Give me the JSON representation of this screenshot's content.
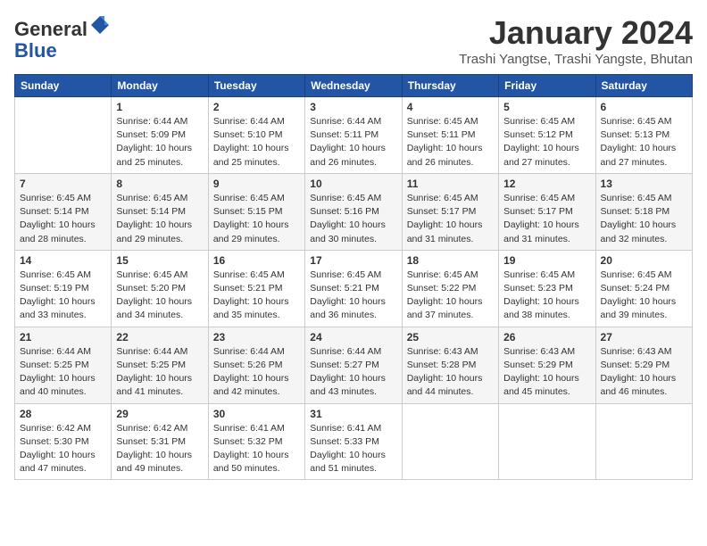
{
  "logo": {
    "general": "General",
    "blue": "Blue"
  },
  "header": {
    "month_title": "January 2024",
    "subtitle": "Trashi Yangtse, Trashi Yangste, Bhutan"
  },
  "days_of_week": [
    "Sunday",
    "Monday",
    "Tuesday",
    "Wednesday",
    "Thursday",
    "Friday",
    "Saturday"
  ],
  "weeks": [
    [
      {
        "day": "",
        "info": ""
      },
      {
        "day": "1",
        "info": "Sunrise: 6:44 AM\nSunset: 5:09 PM\nDaylight: 10 hours\nand 25 minutes."
      },
      {
        "day": "2",
        "info": "Sunrise: 6:44 AM\nSunset: 5:10 PM\nDaylight: 10 hours\nand 25 minutes."
      },
      {
        "day": "3",
        "info": "Sunrise: 6:44 AM\nSunset: 5:11 PM\nDaylight: 10 hours\nand 26 minutes."
      },
      {
        "day": "4",
        "info": "Sunrise: 6:45 AM\nSunset: 5:11 PM\nDaylight: 10 hours\nand 26 minutes."
      },
      {
        "day": "5",
        "info": "Sunrise: 6:45 AM\nSunset: 5:12 PM\nDaylight: 10 hours\nand 27 minutes."
      },
      {
        "day": "6",
        "info": "Sunrise: 6:45 AM\nSunset: 5:13 PM\nDaylight: 10 hours\nand 27 minutes."
      }
    ],
    [
      {
        "day": "7",
        "info": "Sunrise: 6:45 AM\nSunset: 5:14 PM\nDaylight: 10 hours\nand 28 minutes."
      },
      {
        "day": "8",
        "info": "Sunrise: 6:45 AM\nSunset: 5:14 PM\nDaylight: 10 hours\nand 29 minutes."
      },
      {
        "day": "9",
        "info": "Sunrise: 6:45 AM\nSunset: 5:15 PM\nDaylight: 10 hours\nand 29 minutes."
      },
      {
        "day": "10",
        "info": "Sunrise: 6:45 AM\nSunset: 5:16 PM\nDaylight: 10 hours\nand 30 minutes."
      },
      {
        "day": "11",
        "info": "Sunrise: 6:45 AM\nSunset: 5:17 PM\nDaylight: 10 hours\nand 31 minutes."
      },
      {
        "day": "12",
        "info": "Sunrise: 6:45 AM\nSunset: 5:17 PM\nDaylight: 10 hours\nand 31 minutes."
      },
      {
        "day": "13",
        "info": "Sunrise: 6:45 AM\nSunset: 5:18 PM\nDaylight: 10 hours\nand 32 minutes."
      }
    ],
    [
      {
        "day": "14",
        "info": "Sunrise: 6:45 AM\nSunset: 5:19 PM\nDaylight: 10 hours\nand 33 minutes."
      },
      {
        "day": "15",
        "info": "Sunrise: 6:45 AM\nSunset: 5:20 PM\nDaylight: 10 hours\nand 34 minutes."
      },
      {
        "day": "16",
        "info": "Sunrise: 6:45 AM\nSunset: 5:21 PM\nDaylight: 10 hours\nand 35 minutes."
      },
      {
        "day": "17",
        "info": "Sunrise: 6:45 AM\nSunset: 5:21 PM\nDaylight: 10 hours\nand 36 minutes."
      },
      {
        "day": "18",
        "info": "Sunrise: 6:45 AM\nSunset: 5:22 PM\nDaylight: 10 hours\nand 37 minutes."
      },
      {
        "day": "19",
        "info": "Sunrise: 6:45 AM\nSunset: 5:23 PM\nDaylight: 10 hours\nand 38 minutes."
      },
      {
        "day": "20",
        "info": "Sunrise: 6:45 AM\nSunset: 5:24 PM\nDaylight: 10 hours\nand 39 minutes."
      }
    ],
    [
      {
        "day": "21",
        "info": "Sunrise: 6:44 AM\nSunset: 5:25 PM\nDaylight: 10 hours\nand 40 minutes."
      },
      {
        "day": "22",
        "info": "Sunrise: 6:44 AM\nSunset: 5:25 PM\nDaylight: 10 hours\nand 41 minutes."
      },
      {
        "day": "23",
        "info": "Sunrise: 6:44 AM\nSunset: 5:26 PM\nDaylight: 10 hours\nand 42 minutes."
      },
      {
        "day": "24",
        "info": "Sunrise: 6:44 AM\nSunset: 5:27 PM\nDaylight: 10 hours\nand 43 minutes."
      },
      {
        "day": "25",
        "info": "Sunrise: 6:43 AM\nSunset: 5:28 PM\nDaylight: 10 hours\nand 44 minutes."
      },
      {
        "day": "26",
        "info": "Sunrise: 6:43 AM\nSunset: 5:29 PM\nDaylight: 10 hours\nand 45 minutes."
      },
      {
        "day": "27",
        "info": "Sunrise: 6:43 AM\nSunset: 5:29 PM\nDaylight: 10 hours\nand 46 minutes."
      }
    ],
    [
      {
        "day": "28",
        "info": "Sunrise: 6:42 AM\nSunset: 5:30 PM\nDaylight: 10 hours\nand 47 minutes."
      },
      {
        "day": "29",
        "info": "Sunrise: 6:42 AM\nSunset: 5:31 PM\nDaylight: 10 hours\nand 49 minutes."
      },
      {
        "day": "30",
        "info": "Sunrise: 6:41 AM\nSunset: 5:32 PM\nDaylight: 10 hours\nand 50 minutes."
      },
      {
        "day": "31",
        "info": "Sunrise: 6:41 AM\nSunset: 5:33 PM\nDaylight: 10 hours\nand 51 minutes."
      },
      {
        "day": "",
        "info": ""
      },
      {
        "day": "",
        "info": ""
      },
      {
        "day": "",
        "info": ""
      }
    ]
  ]
}
